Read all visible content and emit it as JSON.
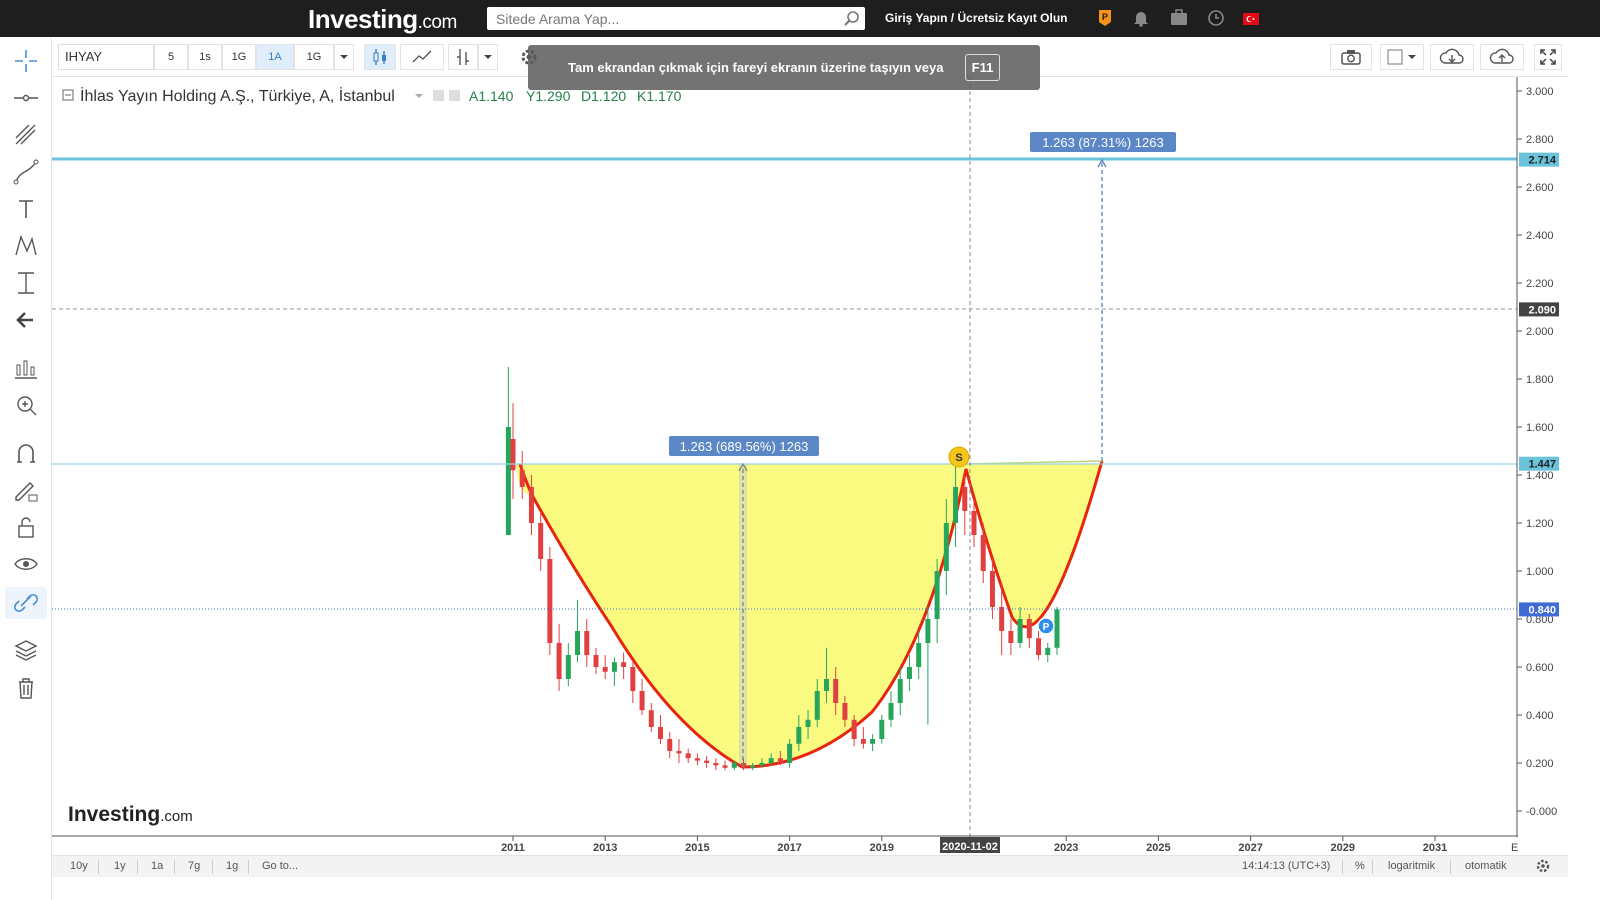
{
  "header": {
    "logo_main": "Investing",
    "logo_suffix": ".com",
    "search_placeholder": "Sitede Arama Yap...",
    "login_text": "Giriş Yapın / Ücretsiz Kayıt Olun"
  },
  "toolbar": {
    "symbol": "IHYAY",
    "intervals": [
      "5",
      "1s",
      "1G",
      "1A",
      "1G"
    ],
    "active_interval": "1A"
  },
  "notice": {
    "text": "Tam ekrandan çıkmak için fareyi ekranın üzerine taşıyın veya",
    "key": "F11"
  },
  "legend": {
    "title": "İhlas Yayın Holding A.Ş., Türkiye, A, İstanbul",
    "open": "A1.140",
    "high": "Y1.290",
    "low": "D1.120",
    "close": "K1.170"
  },
  "measure_labels": {
    "left": "1.263 (689.56%) 1263",
    "right": "1.263 (87.31%) 1263"
  },
  "markers": {
    "s": "S",
    "p": "P"
  },
  "watermark": {
    "main": "Investing",
    "suffix": ".com"
  },
  "chart_data": {
    "type": "candlestick",
    "y_ticks": [
      "3.000",
      "2.800",
      "2.600",
      "2.400",
      "2.200",
      "2.000",
      "1.800",
      "1.600",
      "1.400",
      "1.200",
      "1.000",
      "0.800",
      "0.600",
      "0.400",
      "0.200",
      "-0.000"
    ],
    "x_ticks": [
      "2011",
      "2013",
      "2015",
      "2017",
      "2019",
      "2023",
      "2025",
      "2027",
      "2029",
      "2031"
    ],
    "x_cut_label": "E",
    "crosshair_date": "2020-11-02",
    "price_labels": [
      {
        "value": "2.714",
        "kind": "resistance"
      },
      {
        "value": "2.090",
        "kind": "crosshair"
      },
      {
        "value": "1.447",
        "kind": "rim"
      },
      {
        "value": "0.840",
        "kind": "last"
      }
    ],
    "pattern": "cup-and-handle",
    "series": [
      {
        "values": [
          [
            2010.9,
            1.15,
            1.85,
            1.15,
            1.6
          ],
          [
            2011.0,
            1.55,
            1.7,
            1.3,
            1.42
          ],
          [
            2011.2,
            1.42,
            1.5,
            1.3,
            1.35
          ],
          [
            2011.4,
            1.35,
            1.4,
            1.15,
            1.2
          ],
          [
            2011.6,
            1.2,
            1.25,
            1.0,
            1.05
          ],
          [
            2011.8,
            1.05,
            1.1,
            0.65,
            0.7
          ],
          [
            2012.0,
            0.7,
            0.78,
            0.5,
            0.55
          ],
          [
            2012.2,
            0.55,
            0.7,
            0.52,
            0.65
          ],
          [
            2012.4,
            0.65,
            0.88,
            0.62,
            0.75
          ],
          [
            2012.6,
            0.75,
            0.8,
            0.6,
            0.65
          ],
          [
            2012.8,
            0.65,
            0.68,
            0.57,
            0.6
          ],
          [
            2013.0,
            0.6,
            0.65,
            0.55,
            0.58
          ],
          [
            2013.2,
            0.58,
            0.64,
            0.52,
            0.62
          ],
          [
            2013.4,
            0.62,
            0.66,
            0.55,
            0.6
          ],
          [
            2013.6,
            0.6,
            0.62,
            0.45,
            0.5
          ],
          [
            2013.8,
            0.5,
            0.55,
            0.4,
            0.42
          ],
          [
            2014.0,
            0.42,
            0.45,
            0.33,
            0.35
          ],
          [
            2014.2,
            0.35,
            0.4,
            0.28,
            0.3
          ],
          [
            2014.4,
            0.3,
            0.33,
            0.22,
            0.25
          ],
          [
            2014.6,
            0.25,
            0.3,
            0.2,
            0.24
          ],
          [
            2014.8,
            0.24,
            0.26,
            0.2,
            0.22
          ],
          [
            2015.0,
            0.22,
            0.24,
            0.19,
            0.21
          ],
          [
            2015.2,
            0.21,
            0.23,
            0.18,
            0.2
          ],
          [
            2015.4,
            0.2,
            0.22,
            0.17,
            0.19
          ],
          [
            2015.6,
            0.19,
            0.21,
            0.17,
            0.18
          ],
          [
            2015.8,
            0.18,
            0.21,
            0.17,
            0.2
          ],
          [
            2016.0,
            0.2,
            0.22,
            0.17,
            0.18
          ],
          [
            2016.2,
            0.18,
            0.2,
            0.17,
            0.19
          ],
          [
            2016.4,
            0.19,
            0.22,
            0.18,
            0.2
          ],
          [
            2016.6,
            0.2,
            0.24,
            0.19,
            0.22
          ],
          [
            2016.8,
            0.22,
            0.25,
            0.19,
            0.2
          ],
          [
            2017.0,
            0.2,
            0.3,
            0.18,
            0.28
          ],
          [
            2017.2,
            0.28,
            0.4,
            0.25,
            0.35
          ],
          [
            2017.4,
            0.35,
            0.42,
            0.3,
            0.38
          ],
          [
            2017.6,
            0.38,
            0.55,
            0.35,
            0.5
          ],
          [
            2017.8,
            0.5,
            0.68,
            0.45,
            0.55
          ],
          [
            2018.0,
            0.55,
            0.6,
            0.4,
            0.45
          ],
          [
            2018.2,
            0.45,
            0.48,
            0.35,
            0.38
          ],
          [
            2018.4,
            0.38,
            0.4,
            0.27,
            0.3
          ],
          [
            2018.6,
            0.3,
            0.35,
            0.26,
            0.28
          ],
          [
            2018.8,
            0.28,
            0.32,
            0.25,
            0.3
          ],
          [
            2019.0,
            0.3,
            0.4,
            0.28,
            0.38
          ],
          [
            2019.2,
            0.38,
            0.5,
            0.35,
            0.45
          ],
          [
            2019.4,
            0.45,
            0.6,
            0.4,
            0.55
          ],
          [
            2019.6,
            0.55,
            0.65,
            0.5,
            0.6
          ],
          [
            2019.8,
            0.6,
            0.75,
            0.55,
            0.7
          ],
          [
            2020.0,
            0.7,
            0.85,
            0.36,
            0.8
          ],
          [
            2020.2,
            0.8,
            1.05,
            0.7,
            1.0
          ],
          [
            2020.4,
            1.0,
            1.3,
            0.9,
            1.2
          ],
          [
            2020.6,
            1.2,
            1.45,
            1.1,
            1.35
          ],
          [
            2020.8,
            1.35,
            1.4,
            1.15,
            1.25
          ],
          [
            2021.0,
            1.25,
            1.3,
            1.1,
            1.15
          ],
          [
            2021.2,
            1.15,
            1.2,
            0.95,
            1.0
          ],
          [
            2021.4,
            1.0,
            1.05,
            0.8,
            0.85
          ],
          [
            2021.6,
            0.85,
            0.95,
            0.65,
            0.75
          ],
          [
            2021.8,
            0.75,
            0.8,
            0.65,
            0.7
          ],
          [
            2022.0,
            0.7,
            0.85,
            0.68,
            0.8
          ],
          [
            2022.2,
            0.8,
            0.82,
            0.68,
            0.72
          ],
          [
            2022.4,
            0.72,
            0.75,
            0.63,
            0.65
          ],
          [
            2022.6,
            0.65,
            0.7,
            0.62,
            0.68
          ],
          [
            2022.8,
            0.68,
            0.85,
            0.65,
            0.84
          ]
        ]
      }
    ]
  },
  "bottombar": {
    "ranges": [
      "10y",
      "1y",
      "1a",
      "7g",
      "1g"
    ],
    "goto": "Go to...",
    "time": "14:14:13 (UTC+3)",
    "percent": "%",
    "log": "logaritmik",
    "auto": "otomatik"
  },
  "colors": {
    "cup_fill": "#fafa7a",
    "cup_curve": "#e8260e",
    "up": "#26a65b",
    "down": "#e04040",
    "resistance": "#6ac3db",
    "last_price": "#3f6bd6",
    "label_bg": "#5b87c7"
  }
}
